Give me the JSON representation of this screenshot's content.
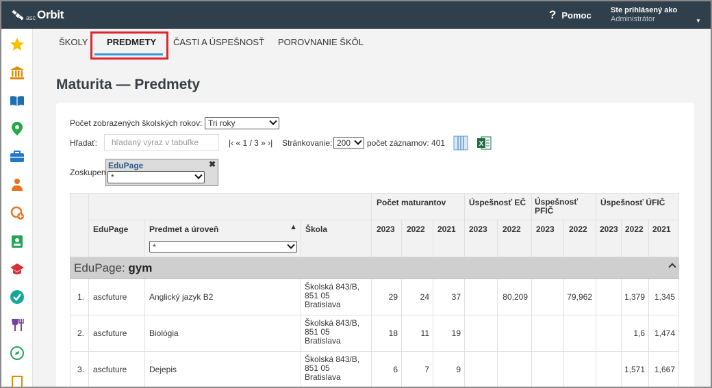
{
  "app": {
    "logo_text": "Orbit",
    "logo_sub": "asc",
    "help_label": "Pomoc",
    "user_line1": "Ste prihlásený ako",
    "user_line2": "Administrátor"
  },
  "sidebar": {
    "icons": [
      "star-icon",
      "bank-icon",
      "book-icon",
      "map-pin-icon",
      "briefcase-icon",
      "student-icon",
      "graduation-add-icon",
      "badge-icon",
      "graduation-cap-icon",
      "check-circle-icon",
      "cutlery-icon",
      "compass-icon",
      "document-icon"
    ]
  },
  "tabs": {
    "skoly": "ŠKOLY",
    "predmety": "PREDMETY",
    "casti": "ČASTI A ÚSPEŠNOSŤ",
    "porovnanie": "POROVNANIE ŠKÔL"
  },
  "page": {
    "title": "Maturita — Predmety"
  },
  "filters": {
    "years_label": "Počet zobrazených školských rokov:",
    "years_value": "Tri roky",
    "search_label": "Hľadať:",
    "search_placeholder": "hľadaný výraz v tabuľke",
    "pager": "|‹ « 1 / 3 » ›|",
    "paging_label": "Stránkovanie:",
    "paging_value": "200",
    "records": "počet záznamov: 401",
    "grouping_label": "Zoskupenie:",
    "group_title": "EduPage",
    "group_value": "*"
  },
  "table": {
    "h_edupage": "EduPage",
    "h_predmet": "Predmet a úroveň",
    "h_skola": "Škola",
    "h_pocet": "Počet maturantov",
    "h_ec": "Úspešnosť EČ",
    "h_pfic": "Úspešnosť PFIČ",
    "h_ufic": "Úspešnosť ÚFIČ",
    "sort_arrow": "▲",
    "predmet_filter": "*",
    "years3": [
      "2023",
      "2022",
      "2021"
    ],
    "years2": [
      "2023",
      "2022"
    ],
    "group_prefix": "EduPage:",
    "group_name": "gym",
    "rows": [
      {
        "no": "1.",
        "edupage": "ascfuture",
        "predmet": "Anglický jazyk B2",
        "skola1": "Školská 843/B,",
        "skola2": "851 05",
        "skola3": "Bratislava",
        "p23": "29",
        "p22": "24",
        "p21": "37",
        "ec23": "",
        "ec22": "80,209",
        "pf23": "",
        "pf22": "79,962",
        "uf23": "",
        "uf22": "1,379",
        "uf21": "1,345"
      },
      {
        "no": "2.",
        "edupage": "ascfuture",
        "predmet": "Biológia",
        "skola1": "Školská 843/B,",
        "skola2": "851 05",
        "skola3": "Bratislava",
        "p23": "18",
        "p22": "11",
        "p21": "19",
        "ec23": "",
        "ec22": "",
        "pf23": "",
        "pf22": "",
        "uf23": "",
        "uf22": "1,6",
        "uf21": "1,474"
      },
      {
        "no": "3.",
        "edupage": "ascfuture",
        "predmet": "Dejepis",
        "skola1": "Školská 843/B,",
        "skola2": "851 05",
        "skola3": "Bratislava",
        "p23": "6",
        "p22": "7",
        "p21": "9",
        "ec23": "",
        "ec22": "",
        "pf23": "",
        "pf22": "",
        "uf23": "",
        "uf22": "1,571",
        "uf21": "1,667"
      }
    ]
  },
  "colors": {
    "topbar": "#2f3f4c",
    "accent": "#2b9ae0",
    "highlight": "#e0242c"
  }
}
